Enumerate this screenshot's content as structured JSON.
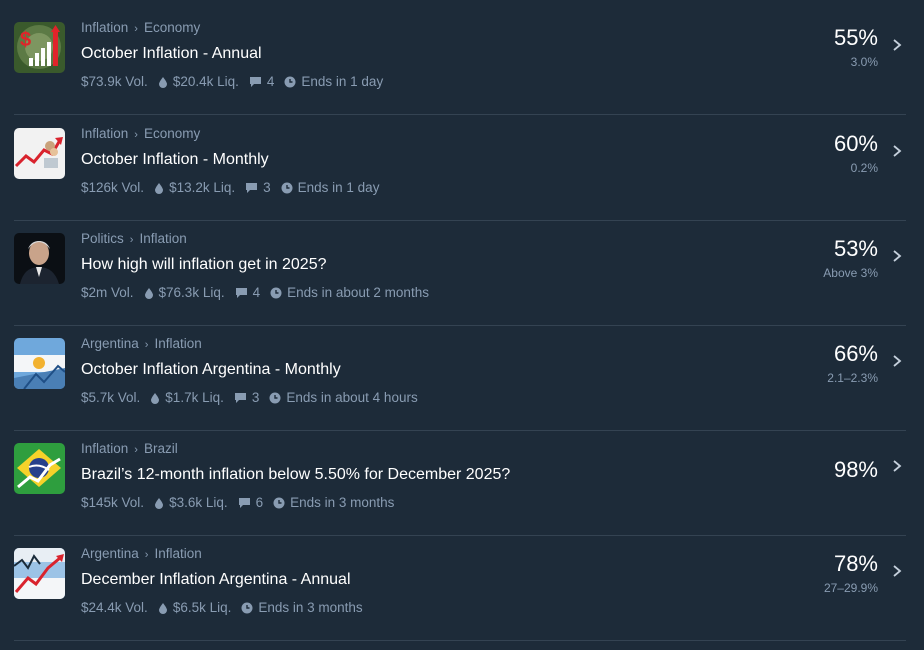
{
  "markets": [
    {
      "crumbs": [
        "Inflation",
        "Economy"
      ],
      "title": "October Inflation - Annual",
      "volume": "$73.9k Vol.",
      "liquidity": "$20.4k Liq.",
      "comments": "4",
      "ends": "Ends in 1 day",
      "percent": "55%",
      "sub": "3.0%",
      "icon": "inflation-chart-icon"
    },
    {
      "crumbs": [
        "Inflation",
        "Economy"
      ],
      "title": "October Inflation - Monthly",
      "volume": "$126k Vol.",
      "liquidity": "$13.2k Liq.",
      "comments": "3",
      "ends": "Ends in 1 day",
      "percent": "60%",
      "sub": "0.2%",
      "icon": "rising-arrow-icon"
    },
    {
      "crumbs": [
        "Politics",
        "Inflation"
      ],
      "title": "How high will inflation get in 2025?",
      "volume": "$2m Vol.",
      "liquidity": "$76.3k Liq.",
      "comments": "4",
      "ends": "Ends in about 2 months",
      "percent": "53%",
      "sub": "Above 3%",
      "icon": "portrait-icon"
    },
    {
      "crumbs": [
        "Argentina",
        "Inflation"
      ],
      "title": "October Inflation Argentina - Monthly",
      "volume": "$5.7k Vol.",
      "liquidity": "$1.7k Liq.",
      "comments": "3",
      "ends": "Ends in about 4 hours",
      "percent": "66%",
      "sub": "2.1–2.3%",
      "icon": "argentina-flag-icon"
    },
    {
      "crumbs": [
        "Inflation",
        "Brazil"
      ],
      "title": "Brazil’s 12-month inflation below 5.50% for December 2025?",
      "volume": "$145k Vol.",
      "liquidity": "$3.6k Liq.",
      "comments": "6",
      "ends": "Ends in 3 months",
      "percent": "98%",
      "sub": "",
      "icon": "brazil-flag-icon"
    },
    {
      "crumbs": [
        "Argentina",
        "Inflation"
      ],
      "title": "December Inflation Argentina - Annual",
      "volume": "$24.4k Vol.",
      "liquidity": "$6.5k Liq.",
      "comments": "",
      "ends": "Ends in 3 months",
      "percent": "78%",
      "sub": "27–29.9%",
      "icon": "argentina-chart-icon"
    }
  ],
  "colors": {
    "background": "#1d2b39",
    "divider": "#344352",
    "muted_text": "#899cb2",
    "primary_text": "#ffffff"
  }
}
